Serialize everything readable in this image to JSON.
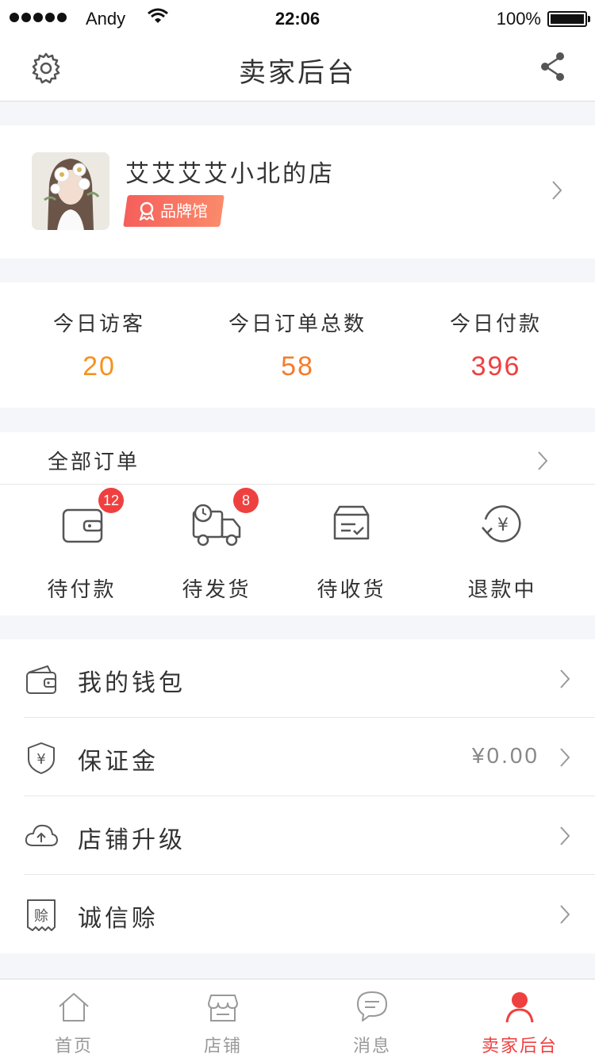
{
  "status_bar": {
    "carrier": "Andy",
    "time": "22:06",
    "battery": "100%"
  },
  "navbar": {
    "title": "卖家后台",
    "left_icon": "gear-icon",
    "right_icon": "share-icon"
  },
  "shop": {
    "name": "艾艾艾艾小北的店",
    "badge": "品牌馆"
  },
  "stats": [
    {
      "label": "今日访客",
      "value": "20",
      "color": "#f5921e"
    },
    {
      "label": "今日订单总数",
      "value": "58",
      "color": "#f57c2c"
    },
    {
      "label": "今日付款",
      "value": "396",
      "color": "#ef4040"
    }
  ],
  "orders": {
    "title": "全部订单",
    "items": [
      {
        "label": "待付款",
        "icon": "wallet-icon",
        "count": "12"
      },
      {
        "label": "待发货",
        "icon": "truck-icon",
        "count": "8"
      },
      {
        "label": "待收货",
        "icon": "package-icon",
        "count": ""
      },
      {
        "label": "退款中",
        "icon": "refund-icon",
        "count": ""
      }
    ]
  },
  "menu": [
    {
      "label": "我的钱包",
      "icon": "wallet-icon",
      "value": ""
    },
    {
      "label": "保证金",
      "icon": "shield-yen-icon",
      "value": "¥0.00"
    },
    {
      "label": "店铺升级",
      "icon": "cloud-upload-icon",
      "value": ""
    },
    {
      "label": "诚信赊",
      "icon": "credit-icon",
      "value": ""
    }
  ],
  "tabbar": [
    {
      "label": "首页",
      "icon": "home-icon",
      "active": false
    },
    {
      "label": "店铺",
      "icon": "store-icon",
      "active": false
    },
    {
      "label": "消息",
      "icon": "message-icon",
      "active": false
    },
    {
      "label": "卖家后台",
      "icon": "person-icon",
      "active": true
    }
  ],
  "colors": {
    "accent": "#ef4040",
    "background": "#f4f6f9"
  }
}
